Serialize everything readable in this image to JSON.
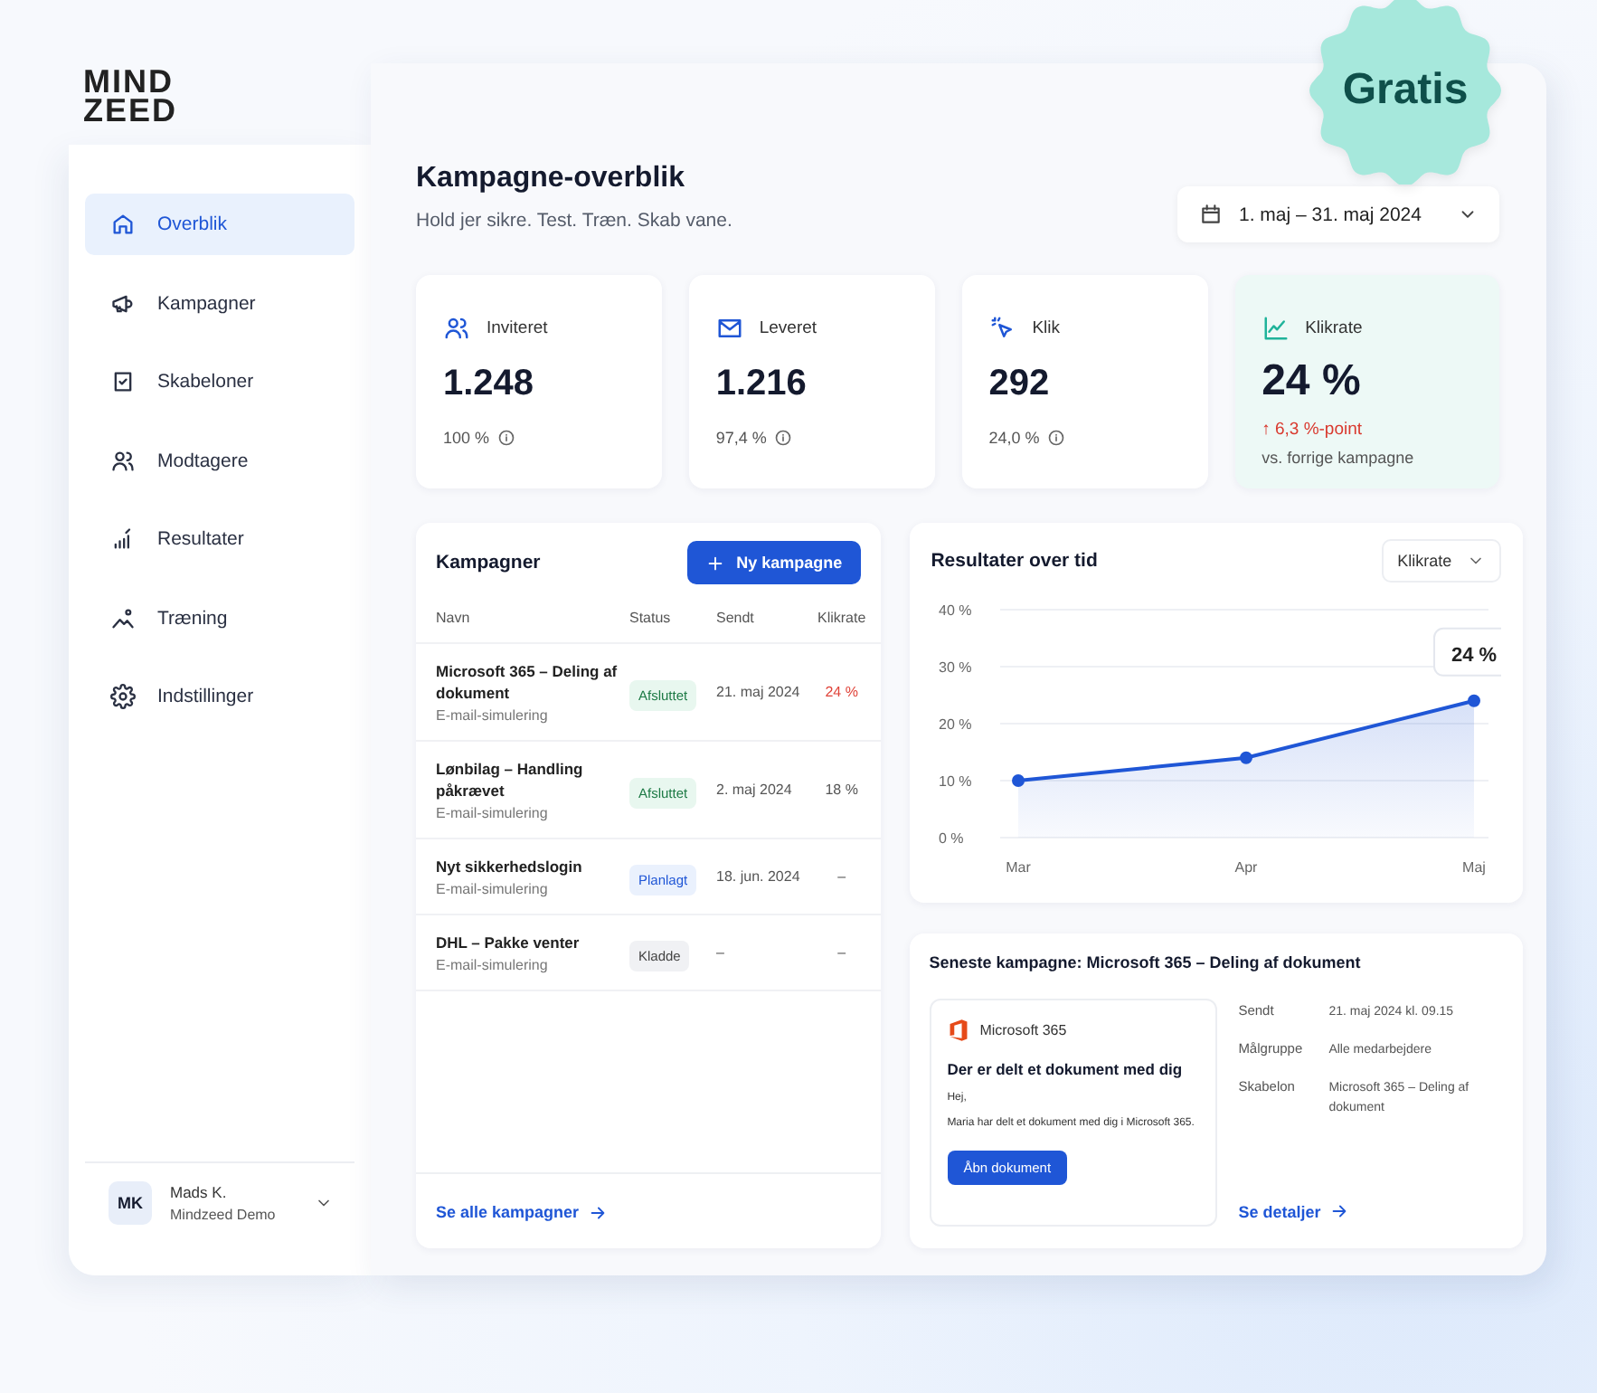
{
  "logo": {
    "line_1": "MIND",
    "line_2": "ZEED"
  },
  "badge": "Gratis",
  "sidebar": {
    "items": [
      {
        "label": "Overblik",
        "selected": true
      },
      {
        "label": "Kampagner",
        "selected": false
      },
      {
        "label": "Skabeloner",
        "selected": false
      },
      {
        "label": "Modtagere",
        "selected": false
      },
      {
        "label": "Resultater",
        "selected": false
      },
      {
        "label": "Træning",
        "selected": false
      },
      {
        "label": "Indstillinger",
        "selected": false
      }
    ],
    "user": {
      "initials": "MK",
      "name": "Mads K.",
      "org": "Mindzeed Demo"
    }
  },
  "header": {
    "title": "Kampagne-overblik",
    "subtitle": "Hold jer sikre. Test. Træn. Skab vane.",
    "date_range": "1. maj – 31. maj 2024"
  },
  "stats": [
    {
      "kind": "basic",
      "label": "Inviteret",
      "value": "1.248",
      "note": "100 %"
    },
    {
      "kind": "basic",
      "label": "Leveret",
      "value": "1.216",
      "note": "97,4 %"
    },
    {
      "kind": "basic",
      "label": "Klik",
      "value": "292",
      "note": "24,0 %"
    },
    {
      "kind": "trend",
      "label": "Klikrate",
      "value": "24 %",
      "change": "↑ 6,3 %-point",
      "note": "vs. forrige kampagne"
    }
  ],
  "campaigns": {
    "title": "Kampagner",
    "new_button": "Ny kampagne",
    "columns": [
      "Navn",
      "Status",
      "Sendt",
      "Klikrate"
    ],
    "rows": [
      {
        "name": "Microsoft 365 – Deling af dokument",
        "type": "E-mail-simulering",
        "status": "Afsluttet",
        "kind": "done",
        "sent": "21. maj 2024",
        "rate": "24 %",
        "flagged": true
      },
      {
        "name": "Lønbilag – Handling påkrævet",
        "type": "E-mail-simulering",
        "status": "Afsluttet",
        "kind": "done",
        "sent": "2. maj 2024",
        "rate": "18 %",
        "flagged": false
      },
      {
        "name": "Nyt sikkerhedslogin",
        "type": "E-mail-simulering",
        "status": "Planlagt",
        "kind": "planned",
        "sent": "18. jun. 2024",
        "rate": "–",
        "flagged": false
      },
      {
        "name": "DHL – Pakke venter",
        "type": "E-mail-simulering",
        "status": "Kladde",
        "kind": "draft",
        "sent": "–",
        "rate": "–",
        "flagged": false
      }
    ],
    "footer_link": "Se alle kampagner"
  },
  "results": {
    "title": "Resultater over tid",
    "metric": "Klikrate",
    "chart_data": {
      "type": "area",
      "categories": [
        "Mar",
        "Apr",
        "Maj"
      ],
      "series": [
        {
          "color": "#1f56d6",
          "values": [
            10,
            14,
            24
          ]
        }
      ],
      "grid": true,
      "ylim": [
        0,
        40
      ],
      "yticks": [
        {
          "value": 0,
          "label": "0 %"
        },
        {
          "value": 10,
          "label": "10 %"
        },
        {
          "value": 20,
          "label": "20 %"
        },
        {
          "value": 30,
          "label": "30 %"
        },
        {
          "value": 40,
          "label": "40 %"
        }
      ],
      "annotations": [
        {
          "x": "Maj",
          "y": 24,
          "text": "24 %"
        }
      ]
    }
  },
  "latest": {
    "title": "Seneste kampagne: Microsoft 365 – Deling af dokument",
    "preview": {
      "brand": "Microsoft 365",
      "heading": "Der er delt et dokument med dig",
      "greeting": "Hej,",
      "body": "Maria har delt et dokument med dig i Microsoft 365.",
      "button": "Åbn dokument"
    },
    "details": [
      {
        "label": "Sendt",
        "value": "21. maj 2024 kl. 09.15"
      },
      {
        "label": "Målgruppe",
        "value": "Alle medarbejdere"
      },
      {
        "label": "Skabelon",
        "value": "Microsoft 365 – Deling af dokument"
      }
    ],
    "link": "Se detaljer"
  }
}
